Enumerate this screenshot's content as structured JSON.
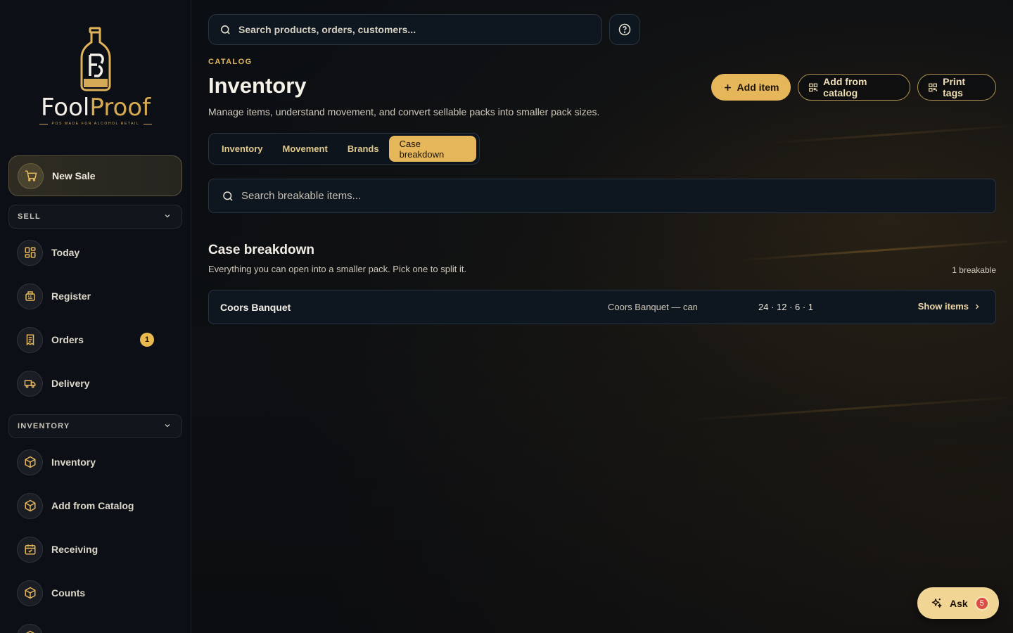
{
  "brand": {
    "name_part1": "Fool",
    "name_part2": "Proof",
    "tagline": "POS MADE FOR ALCOHOL RETAIL",
    "accent": "#e6b65a"
  },
  "sidebar": {
    "new_sale": {
      "label": "New Sale",
      "icon": "cart-icon"
    },
    "sections": [
      {
        "title": "SELL",
        "items": [
          {
            "label": "Today",
            "icon": "dashboard-icon"
          },
          {
            "label": "Register",
            "icon": "register-icon"
          },
          {
            "label": "Orders",
            "icon": "receipt-icon",
            "badge": "1"
          },
          {
            "label": "Delivery",
            "icon": "truck-icon"
          }
        ]
      },
      {
        "title": "INVENTORY",
        "items": [
          {
            "label": "Inventory",
            "icon": "box-icon"
          },
          {
            "label": "Add from Catalog",
            "icon": "box-icon"
          },
          {
            "label": "Receiving",
            "icon": "calendar-check-icon"
          },
          {
            "label": "Counts",
            "icon": "box-icon"
          }
        ]
      }
    ]
  },
  "topbar": {
    "search_placeholder": "Search products, orders, customers...",
    "help_icon": "help-circle-icon"
  },
  "header": {
    "eyebrow": "CATALOG",
    "title": "Inventory",
    "subtitle": "Manage items, understand movement, and convert sellable packs into smaller pack sizes.",
    "actions": {
      "add_item": "Add item",
      "add_from_catalog": "Add from catalog",
      "print_tags": "Print tags"
    }
  },
  "tabs": [
    {
      "label": "Inventory",
      "active": false
    },
    {
      "label": "Movement",
      "active": false
    },
    {
      "label": "Brands",
      "active": false
    },
    {
      "label": "Case breakdown",
      "active": true
    }
  ],
  "breakdown": {
    "search_placeholder": "Search breakable items...",
    "title": "Case breakdown",
    "subtitle": "Everything you can open into a smaller pack. Pick one to split it.",
    "count_label": "1 breakable",
    "rows": [
      {
        "name": "Coors Banquet",
        "pack": "Coors Banquet — can",
        "sizes": "24 · 12 · 6 · 1",
        "action": "Show items"
      }
    ]
  },
  "assistant": {
    "label": "Ask",
    "count": "5"
  }
}
